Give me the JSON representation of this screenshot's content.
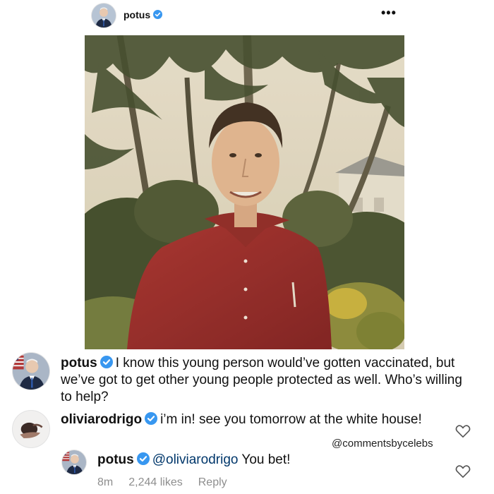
{
  "header": {
    "username": "potus",
    "more_label": "•••"
  },
  "caption": {
    "username": "potus",
    "text": "I know this young person would’ve gotten vaccinated, but we’ve got to get other young people protected as well. Who’s willing to help?"
  },
  "comments": [
    {
      "username": "oliviarodrigo",
      "text": "i’m in! see you tomorrow at the white house!"
    }
  ],
  "reply": {
    "username": "potus",
    "mention": "@oliviarodrigo",
    "text": "You bet!",
    "time": "8m",
    "likes": "2,244 likes",
    "reply_label": "Reply"
  },
  "watermark": "@commentsbycelebs",
  "colors": {
    "verified": "#3897f0",
    "mention": "#00376b",
    "meta": "#8e8e8e"
  }
}
